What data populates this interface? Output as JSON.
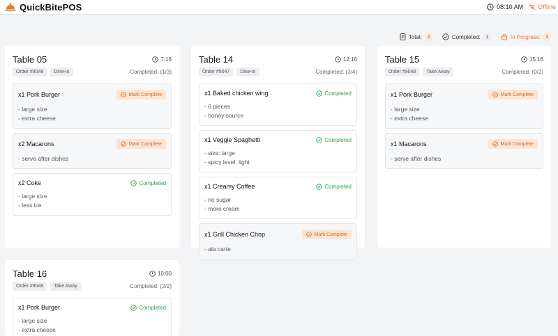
{
  "app": {
    "name": "QuickBitePOS"
  },
  "header": {
    "time": "08:10 AM",
    "status": "Offline"
  },
  "stats": {
    "total_label": "Total:",
    "total_count": "4",
    "completed_label": "Completed:",
    "completed_count": "1",
    "progress_label": "In Progress:",
    "progress_count": "3"
  },
  "colors": {
    "accent": "#e8792f",
    "success": "#2e9e57"
  },
  "orders": [
    {
      "table": "Table 05",
      "time": "7:16",
      "order_no": "Order #9049",
      "type": "Dine-in",
      "completed": "Completed: (1/3)",
      "items": [
        {
          "name": "x1 Pork Burger",
          "notes": [
            "- large size",
            "- extra cheese"
          ],
          "action": "Mark Complete"
        },
        {
          "name": "x2 Macarons",
          "notes": [
            "- serve after dishes"
          ],
          "action": "Mark Complete"
        },
        {
          "name": "x2 Coke",
          "notes": [
            "- large size",
            "- less ice"
          ],
          "status": "Completed"
        }
      ]
    },
    {
      "table": "Table 14",
      "time": "12:16",
      "order_no": "Order #9047",
      "type": "Dine-in",
      "completed": "Completed: (3/4)",
      "items": [
        {
          "name": "x1 Baked chicken wing",
          "notes": [
            "- 6 pieces",
            "- honey source"
          ],
          "status": "Completed"
        },
        {
          "name": "x1 Veggie Spaghetti",
          "notes": [
            "- size: large",
            "- spicy level: light"
          ],
          "status": "Completed"
        },
        {
          "name": "x1 Creamy Coffee",
          "notes": [
            "- no sugar",
            "- more cream"
          ],
          "status": "Completed"
        },
        {
          "name": "x1 Grill Chicken Chop",
          "notes": [
            "- ala carte"
          ],
          "action": "Mark Complete"
        }
      ]
    },
    {
      "table": "Table 15",
      "time": "15:16",
      "order_no": "Order #9048",
      "type": "Take Away",
      "completed": "Completed: (0/2)",
      "items": [
        {
          "name": "x1 Pork Burger",
          "notes": [
            "- large size",
            "- extra cheese"
          ],
          "action": "Mark Complete"
        },
        {
          "name": "x1 Macarons",
          "notes": [
            "- serve after dishes"
          ],
          "action": "Mark Complete"
        }
      ]
    },
    {
      "table": "Table 16",
      "time": "10:00",
      "order_no": "Order #9046",
      "type": "Take Away",
      "completed": "Completed: (2/2)",
      "items": [
        {
          "name": "x1 Pork Burger",
          "notes": [
            "- large size",
            "- extra cheese"
          ],
          "status": "Completed"
        }
      ]
    }
  ]
}
